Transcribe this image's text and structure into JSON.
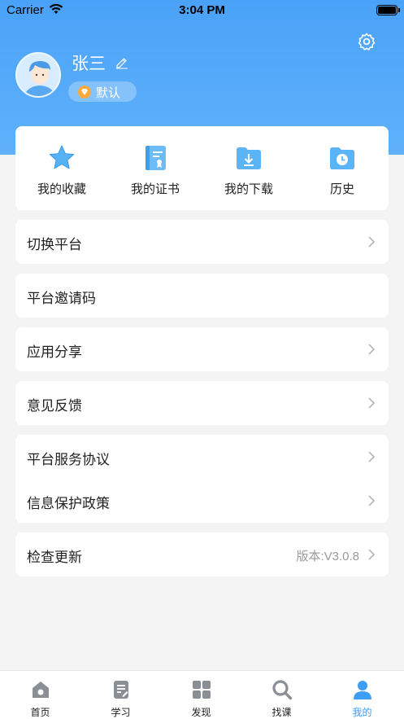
{
  "status_bar": {
    "carrier": "Carrier",
    "time": "3:04 PM"
  },
  "profile": {
    "name": "张三",
    "badge": "默认"
  },
  "quick_actions": [
    {
      "label": "我的收藏",
      "icon": "star-icon"
    },
    {
      "label": "我的证书",
      "icon": "certificate-icon"
    },
    {
      "label": "我的下载",
      "icon": "download-folder-icon"
    },
    {
      "label": "历史",
      "icon": "history-folder-icon"
    }
  ],
  "menu": {
    "switch_platform": "切换平台",
    "invite_code": "平台邀请码",
    "share_app": "应用分享",
    "feedback": "意见反馈",
    "service_agreement": "平台服务协议",
    "privacy_policy": "信息保护政策",
    "check_update": "检查更新",
    "version": "版本:V3.0.8"
  },
  "tabs": [
    {
      "label": "首页",
      "icon": "home-icon"
    },
    {
      "label": "学习",
      "icon": "study-icon"
    },
    {
      "label": "发现",
      "icon": "discover-grid-icon"
    },
    {
      "label": "找课",
      "icon": "search-course-icon"
    },
    {
      "label": "我的",
      "icon": "profile-icon",
      "active": true
    }
  ],
  "colors": {
    "accent": "#3d9df5",
    "hero_top": "#4aa2f8",
    "background": "#f4f4f4"
  }
}
